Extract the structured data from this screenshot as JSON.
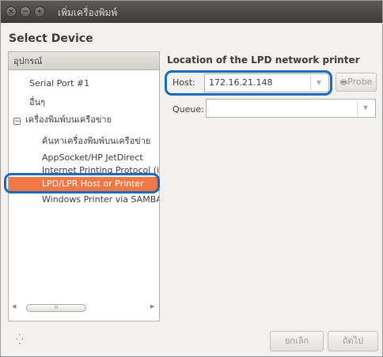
{
  "window": {
    "title": "เพิ่มเครื่องพิมพ์"
  },
  "heading": "Select Device",
  "device_tree": {
    "header": "อุปกรณ์",
    "items": [
      {
        "label": "Serial Port #1"
      },
      {
        "label": "อื่นๆ"
      },
      {
        "label": "เครื่องพิมพ์บนเครือข่าย",
        "expander": "−"
      },
      {
        "label": "ค้นหาเครื่องพิมพ์บนเครือข่าย"
      },
      {
        "label": "AppSocket/HP JetDirect"
      },
      {
        "label": "Internet Printing Protocol (i"
      },
      {
        "label": "LPD/LPR Host or Printer",
        "selected": true
      },
      {
        "label": "Windows Printer via SAMBA"
      }
    ],
    "scrollbar_thumb_glyph": "III"
  },
  "form": {
    "title": "Location of the LPD network printer",
    "host_label": "Host:",
    "host_value": "172.16.21.148",
    "probe_label": "Probe",
    "queue_label": "Queue:",
    "queue_value": ""
  },
  "footer": {
    "cancel_label": "ยกเลิก",
    "next_label": "ถัดไป"
  },
  "icons": {
    "close": "close-icon",
    "minimize": "minimize-icon",
    "maximize": "maximize-icon",
    "printer": "printer-icon",
    "spinner": "spinner-icon",
    "dropdown": "dropdown-arrow-icon"
  },
  "colors": {
    "selection": "#f07746",
    "highlight_ring": "#1a6bb8",
    "titlebar": "#3e3d39"
  }
}
